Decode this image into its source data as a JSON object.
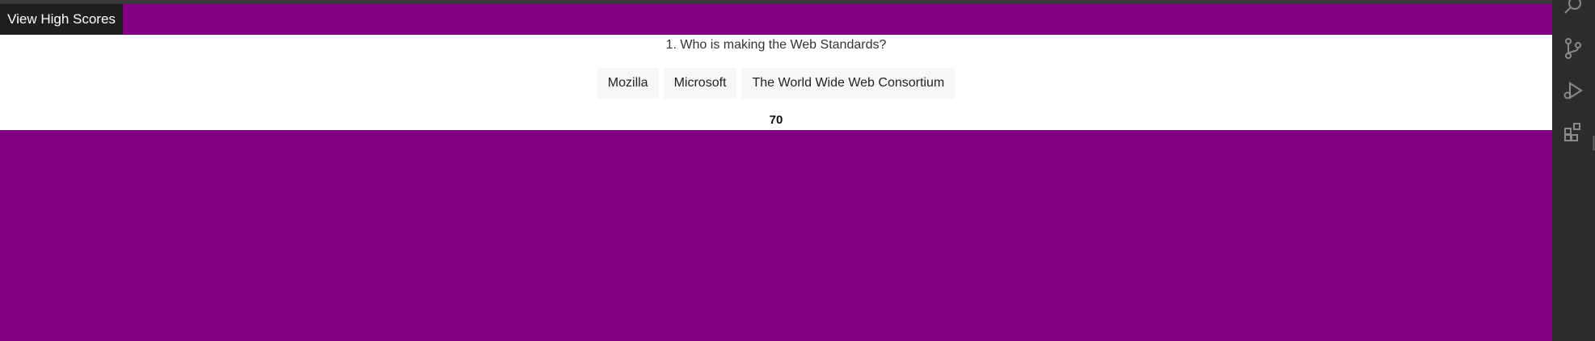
{
  "header": {
    "high_scores_label": "View High Scores"
  },
  "quiz": {
    "question": "1. Who is making the Web Standards?",
    "answers": [
      "Mozilla",
      "Microsoft",
      "The World Wide Web Consortium"
    ],
    "timer": "70"
  },
  "colors": {
    "brand_purple": "#800080",
    "panel_white": "#ffffff",
    "activity_bar": "#2c2c2c"
  },
  "activity_bar": {
    "icons": [
      "search-icon",
      "source-control-icon",
      "run-debug-icon",
      "extensions-icon"
    ]
  }
}
